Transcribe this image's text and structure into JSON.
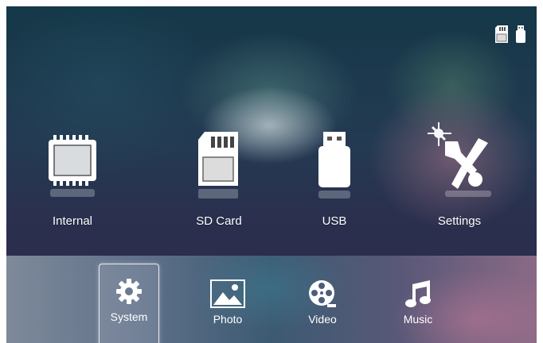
{
  "status": {
    "icons": [
      "sd-card-icon",
      "usb-icon"
    ]
  },
  "sources": [
    {
      "label": "Internal",
      "icon": "internal-memory-icon"
    },
    {
      "label": "SD Card",
      "icon": "sd-card-icon"
    },
    {
      "label": "USB",
      "icon": "usb-icon"
    },
    {
      "label": "Settings",
      "icon": "settings-tools-icon"
    }
  ],
  "tabs": [
    {
      "label": "System",
      "icon": "gear-icon",
      "selected": true
    },
    {
      "label": "Photo",
      "icon": "photo-icon",
      "selected": false
    },
    {
      "label": "Video",
      "icon": "film-reel-icon",
      "selected": false
    },
    {
      "label": "Music",
      "icon": "music-note-icon",
      "selected": false
    }
  ],
  "colors": {
    "icon": "#ffffff",
    "text": "#ffffff",
    "selection_border": "#ffffff"
  }
}
